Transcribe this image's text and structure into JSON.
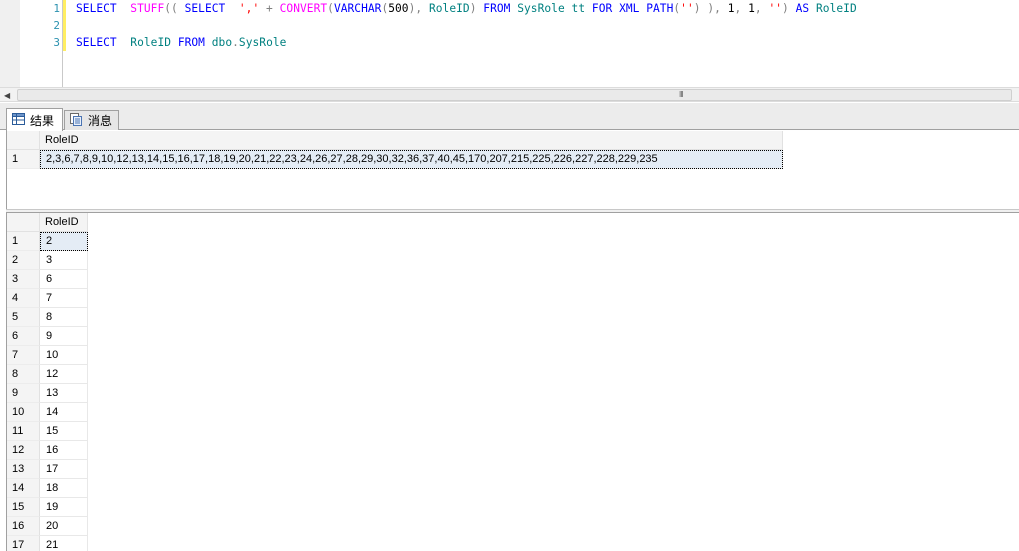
{
  "editor": {
    "line_numbers": [
      "1",
      "2",
      "3"
    ],
    "line1": [
      {
        "c": "k",
        "t": "SELECT"
      },
      {
        "c": "p",
        "t": "  "
      },
      {
        "c": "f",
        "t": "STUFF"
      },
      {
        "c": "g",
        "t": "(( "
      },
      {
        "c": "k",
        "t": "SELECT"
      },
      {
        "c": "p",
        "t": "  "
      },
      {
        "c": "s",
        "t": "','"
      },
      {
        "c": "p",
        "t": " "
      },
      {
        "c": "g",
        "t": "+"
      },
      {
        "c": "p",
        "t": " "
      },
      {
        "c": "f",
        "t": "CONVERT"
      },
      {
        "c": "g",
        "t": "("
      },
      {
        "c": "k",
        "t": "VARCHAR"
      },
      {
        "c": "g",
        "t": "("
      },
      {
        "c": "p",
        "t": "500"
      },
      {
        "c": "g",
        "t": "),"
      },
      {
        "c": "p",
        "t": " "
      },
      {
        "c": "t",
        "t": "RoleID"
      },
      {
        "c": "g",
        "t": ")"
      },
      {
        "c": "p",
        "t": " "
      },
      {
        "c": "k",
        "t": "FROM"
      },
      {
        "c": "p",
        "t": " "
      },
      {
        "c": "t",
        "t": "SysRole"
      },
      {
        "c": "p",
        "t": " "
      },
      {
        "c": "t",
        "t": "tt"
      },
      {
        "c": "p",
        "t": " "
      },
      {
        "c": "k",
        "t": "FOR"
      },
      {
        "c": "p",
        "t": " "
      },
      {
        "c": "k",
        "t": "XML"
      },
      {
        "c": "p",
        "t": " "
      },
      {
        "c": "k",
        "t": "PATH"
      },
      {
        "c": "g",
        "t": "("
      },
      {
        "c": "s",
        "t": "''"
      },
      {
        "c": "g",
        "t": ")"
      },
      {
        "c": "p",
        "t": " "
      },
      {
        "c": "g",
        "t": "),"
      },
      {
        "c": "p",
        "t": " 1"
      },
      {
        "c": "g",
        "t": ","
      },
      {
        "c": "p",
        "t": " 1"
      },
      {
        "c": "g",
        "t": ","
      },
      {
        "c": "p",
        "t": " "
      },
      {
        "c": "s",
        "t": "''"
      },
      {
        "c": "g",
        "t": ")"
      },
      {
        "c": "p",
        "t": " "
      },
      {
        "c": "k",
        "t": "AS"
      },
      {
        "c": "p",
        "t": " "
      },
      {
        "c": "t",
        "t": "RoleID"
      }
    ],
    "line3": [
      {
        "c": "k",
        "t": "SELECT"
      },
      {
        "c": "p",
        "t": "  "
      },
      {
        "c": "t",
        "t": "RoleID"
      },
      {
        "c": "p",
        "t": " "
      },
      {
        "c": "k",
        "t": "FROM"
      },
      {
        "c": "p",
        "t": " "
      },
      {
        "c": "t",
        "t": "dbo"
      },
      {
        "c": "g",
        "t": "."
      },
      {
        "c": "t",
        "t": "SysRole"
      }
    ]
  },
  "scrollbar": {
    "grip": "III"
  },
  "tabs": {
    "results_label": "结果",
    "messages_label": "消息"
  },
  "grid1": {
    "column": "RoleID",
    "rows": [
      {
        "num": "1",
        "value": "2,3,6,7,8,9,10,12,13,14,15,16,17,18,19,20,21,22,23,24,26,27,28,29,30,32,36,37,40,45,170,207,215,225,226,227,228,229,235"
      }
    ]
  },
  "grid2": {
    "column": "RoleID",
    "rows": [
      {
        "num": "1",
        "value": "2"
      },
      {
        "num": "2",
        "value": "3"
      },
      {
        "num": "3",
        "value": "6"
      },
      {
        "num": "4",
        "value": "7"
      },
      {
        "num": "5",
        "value": "8"
      },
      {
        "num": "6",
        "value": "9"
      },
      {
        "num": "7",
        "value": "10"
      },
      {
        "num": "8",
        "value": "12"
      },
      {
        "num": "9",
        "value": "13"
      },
      {
        "num": "10",
        "value": "14"
      },
      {
        "num": "11",
        "value": "15"
      },
      {
        "num": "12",
        "value": "16"
      },
      {
        "num": "13",
        "value": "17"
      },
      {
        "num": "14",
        "value": "18"
      },
      {
        "num": "15",
        "value": "19"
      },
      {
        "num": "16",
        "value": "20"
      },
      {
        "num": "17",
        "value": "21"
      }
    ]
  },
  "icons": {
    "results_tab": "grid-icon",
    "messages_tab": "message-icon"
  }
}
